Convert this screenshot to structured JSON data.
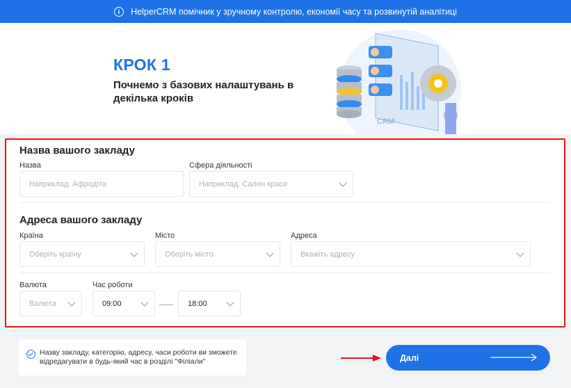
{
  "banner": {
    "text": "HelperCRM помічник у зручному контролю, економії часу та розвинутій аналітиці"
  },
  "hero": {
    "step": "КРОК 1",
    "subtitle": "Почнемо з базових налаштувань в декілька кроків"
  },
  "section_name": {
    "title": "Назва вашого закладу",
    "name_label": "Назва",
    "name_placeholder": "Наприклад: Афродіта",
    "sphere_label": "Сфера діяльності",
    "sphere_placeholder": "Наприклад: Салон краси"
  },
  "section_address": {
    "title": "Адреса вашого закладу",
    "country_label": "Країна",
    "country_placeholder": "Оберіть країну",
    "city_label": "Місто",
    "city_placeholder": "Оберіть місто",
    "address_label": "Адреса",
    "address_placeholder": "Вкажіть адресу"
  },
  "section_extra": {
    "currency_label": "Валюта",
    "currency_placeholder": "Валюта",
    "hours_label": "Час роботи",
    "hours_from": "09:00",
    "hours_to": "18:00"
  },
  "note": {
    "text": "Назву закладу, категорію, адресу, часи роботи ви зможете відредагувати в будь-який час в розділі \"Філіали\""
  },
  "next_button": {
    "label": "Далі"
  },
  "illustration": {
    "badge_text": "CRM"
  },
  "colors": {
    "accent": "#1e72e6",
    "highlight": "#e3141b"
  }
}
